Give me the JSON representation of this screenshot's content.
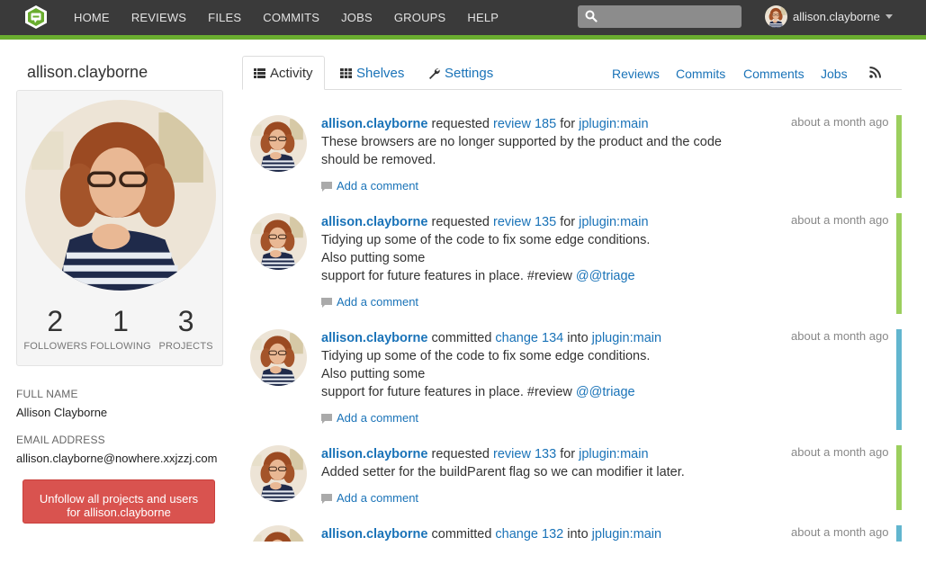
{
  "nav": {
    "items": [
      "HOME",
      "REVIEWS",
      "FILES",
      "COMMITS",
      "JOBS",
      "GROUPS",
      "HELP"
    ],
    "search_placeholder": "",
    "username": "allison.clayborne"
  },
  "colors": {
    "accent_green": "#6aad2f",
    "link_blue": "#1a73b8",
    "review_bar": "#9ccf5e",
    "commit_bar": "#62b6cf",
    "danger": "#d9534f"
  },
  "profile": {
    "name": "allison.clayborne",
    "stats": [
      {
        "num": "2",
        "label": "FOLLOWERS"
      },
      {
        "num": "1",
        "label": "FOLLOWING"
      },
      {
        "num": "3",
        "label": "PROJECTS"
      }
    ],
    "full_name_label": "FULL NAME",
    "full_name": "Allison Clayborne",
    "email_label": "EMAIL ADDRESS",
    "email": "allison.clayborne@nowhere.xxjzzj.com",
    "unfollow_line1": "Unfollow all projects and users",
    "unfollow_line2": "for allison.clayborne"
  },
  "tabs": {
    "activity": "Activity",
    "shelves": "Shelves",
    "settings": "Settings",
    "right_links": [
      "Reviews",
      "Commits",
      "Comments",
      "Jobs"
    ],
    "rss_icon": "rss-icon"
  },
  "activity": [
    {
      "user": "allison.clayborne",
      "verb": "requested",
      "object": "review 185",
      "prep": "for",
      "target": "jplugin:main",
      "message": [
        "These browsers are no longer supported by the product and the code",
        "should be removed."
      ],
      "tag": "",
      "time": "about a month ago",
      "comment": "Add a comment",
      "kind": "review"
    },
    {
      "user": "allison.clayborne",
      "verb": "requested",
      "object": "review 135",
      "prep": "for",
      "target": "jplugin:main",
      "message": [
        "Tidying up some of the code to fix some edge conditions.",
        "Also putting some",
        "support for future features in place. #review"
      ],
      "tag": "@@triage",
      "time": "about a month ago",
      "comment": "Add a comment",
      "kind": "review"
    },
    {
      "user": "allison.clayborne",
      "verb": "committed",
      "object": "change 134",
      "prep": "into",
      "target": "jplugin:main",
      "message": [
        "Tidying up some of the code to fix some edge conditions.",
        "Also putting some",
        "support for future features in place. #review"
      ],
      "tag": "@@triage",
      "time": "about a month ago",
      "comment": "Add a comment",
      "kind": "commit"
    },
    {
      "user": "allison.clayborne",
      "verb": "requested",
      "object": "review 133",
      "prep": "for",
      "target": "jplugin:main",
      "message": [
        "Added setter for the buildParent flag so we can modifier it later."
      ],
      "tag": "",
      "time": "about a month ago",
      "comment": "Add a comment",
      "kind": "review"
    },
    {
      "user": "allison.clayborne",
      "verb": "committed",
      "object": "change 132",
      "prep": "into",
      "target": "jplugin:main",
      "message": [],
      "tag": "",
      "time": "about a month ago",
      "comment": "",
      "kind": "commit"
    }
  ]
}
